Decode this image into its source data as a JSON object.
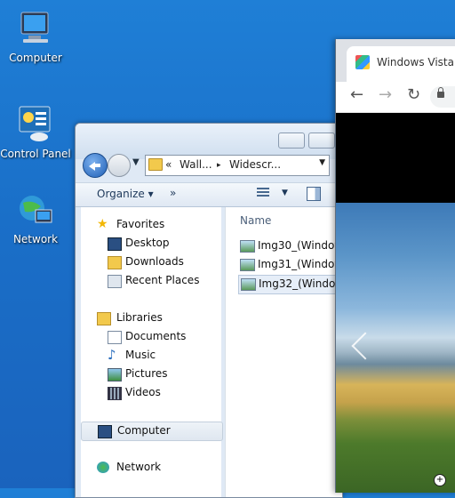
{
  "desktop": {
    "icons": [
      {
        "label": "Computer"
      },
      {
        "label": "Control Panel"
      },
      {
        "label": "Network"
      }
    ]
  },
  "explorer": {
    "address": {
      "prefix": "«",
      "seg1": "Wall...",
      "sep": "▸",
      "seg2": "Widescr..."
    },
    "toolbar": {
      "organize": "Organize ▾",
      "more": "»"
    },
    "nav": {
      "favorites": "Favorites",
      "desktop": "Desktop",
      "downloads": "Downloads",
      "recent": "Recent Places",
      "libraries": "Libraries",
      "documents": "Documents",
      "music": "Music",
      "pictures": "Pictures",
      "videos": "Videos",
      "computer": "Computer",
      "network": "Network"
    },
    "column_header": "Name",
    "files": [
      "Img30_(Window",
      "Img31_(Window",
      "Img32_(Window"
    ]
  },
  "browser": {
    "tab_title": "Windows Vista -",
    "nav": {
      "back": "←",
      "forward": "→",
      "reload": "↻"
    }
  }
}
